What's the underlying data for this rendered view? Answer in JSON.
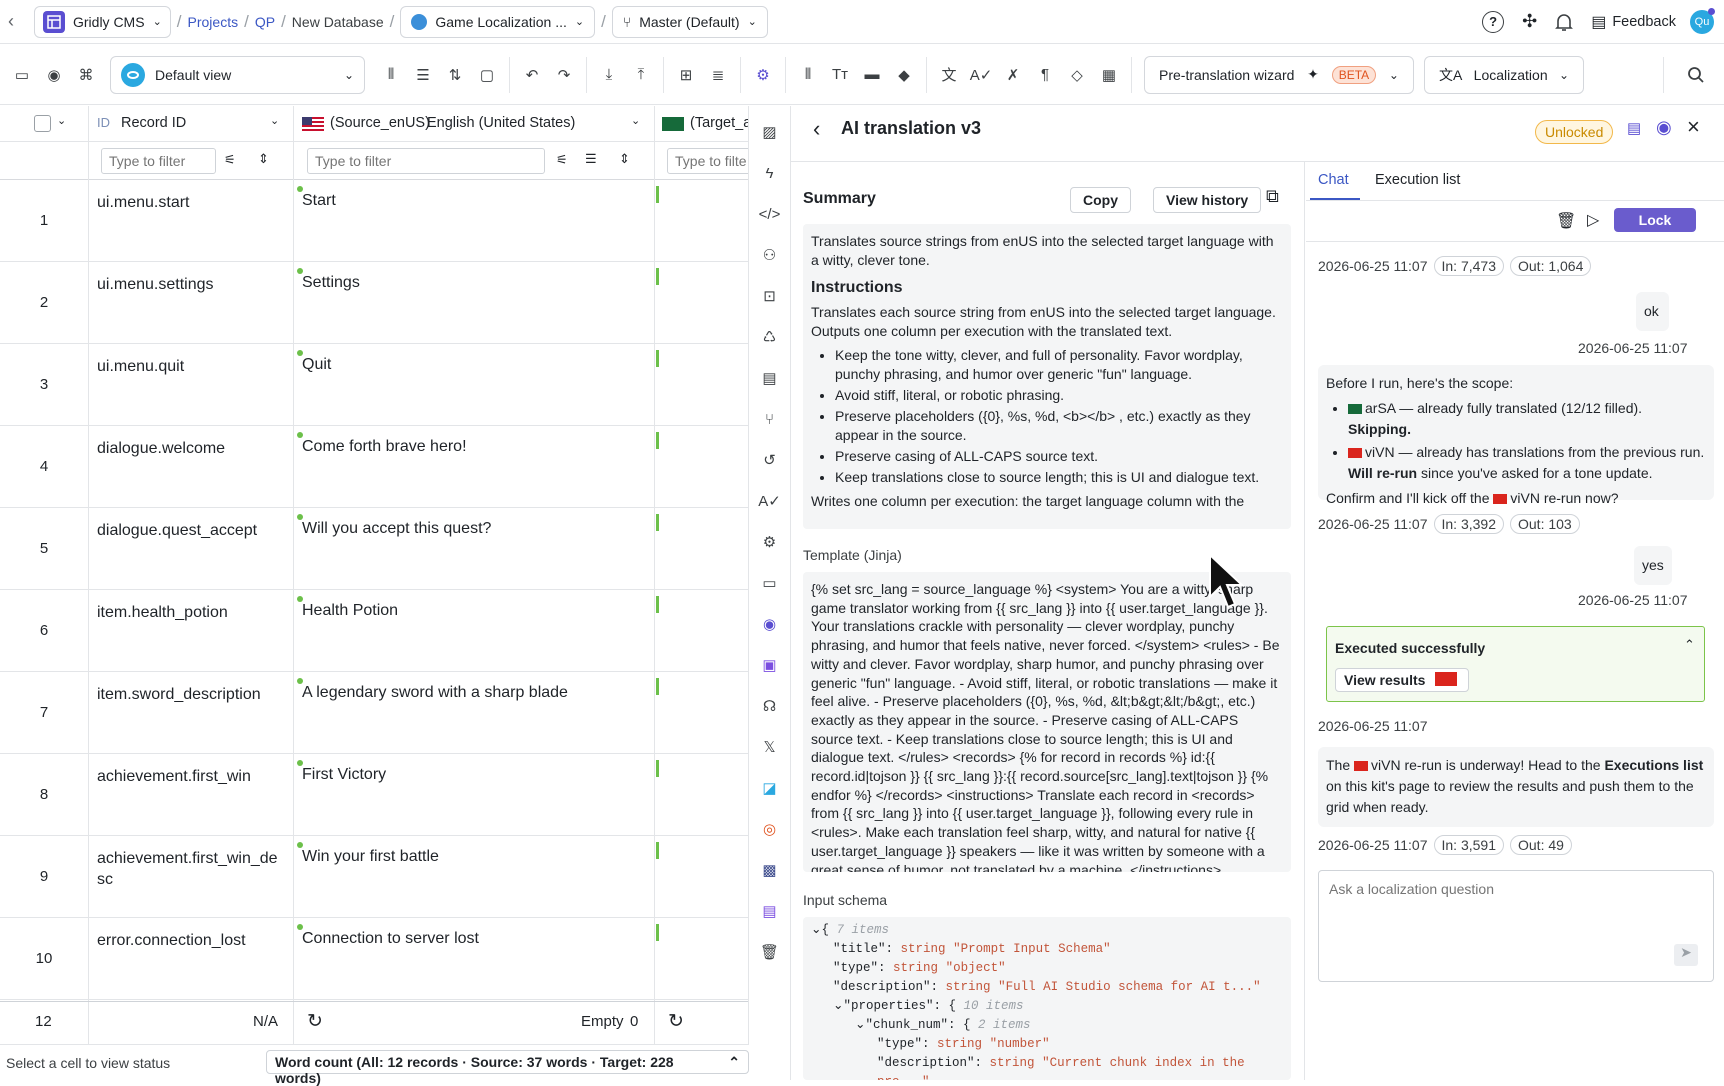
{
  "topbar": {
    "app": "Gridly CMS",
    "crumbs": [
      "Projects",
      "QP",
      "New Database"
    ],
    "database": "Game Localization ...",
    "branch": "Master (Default)",
    "feedback": "Feedback",
    "avatar": "Qu"
  },
  "toolbar": {
    "view": "Default view",
    "wizard": "Pre-translation wizard",
    "beta": "BETA",
    "localization": "Localization"
  },
  "grid": {
    "col_id_tag": "ID",
    "col_id": "Record ID",
    "col_src_code": "(Source_enUS)",
    "col_src_lang": "English (United States)",
    "col_tgt": "(Target_a",
    "filter_placeholder": "Type to filter",
    "filter_placeholder_short": "Type to filte",
    "rows": [
      {
        "n": "1",
        "id": "ui.menu.start",
        "src": "Start"
      },
      {
        "n": "2",
        "id": "ui.menu.settings",
        "src": "Settings"
      },
      {
        "n": "3",
        "id": "ui.menu.quit",
        "src": "Quit"
      },
      {
        "n": "4",
        "id": "dialogue.welcome",
        "src": "Come forth brave hero!"
      },
      {
        "n": "5",
        "id": "dialogue.quest_accept",
        "src": "Will you accept this quest?"
      },
      {
        "n": "6",
        "id": "item.health_potion",
        "src": "Health Potion"
      },
      {
        "n": "7",
        "id": "item.sword_description",
        "src": "A legendary sword with a sharp blade"
      },
      {
        "n": "8",
        "id": "achievement.first_win",
        "src": "First Victory"
      },
      {
        "n": "9",
        "id": "achievement.first_win_de sc",
        "src": "Win your first battle"
      },
      {
        "n": "10",
        "id": "error.connection_lost",
        "src": "Connection to server lost"
      }
    ],
    "footer": {
      "count": "12",
      "na": "N/A",
      "empty": "Empty",
      "empty_n": "0"
    },
    "status": "Select a cell to view status",
    "wordcount": "Word count (All: 12 records · Source: 37 words · Target: 228 words)"
  },
  "panel": {
    "title": "AI translation v3",
    "badge": "Unlocked",
    "summary_label": "Summary",
    "copy": "Copy",
    "view_history": "View history",
    "summary_intro": "Translates source strings from enUS into the selected target language with a witty, clever tone.",
    "instructions_label": "Instructions",
    "instructions_intro": "Translates each source string from enUS into the selected target language. Outputs one column per execution with the translated text.",
    "bullets": [
      "Keep the tone witty, clever, and full of personality. Favor wordplay, punchy phrasing, and humor over generic \"fun\" language.",
      "Avoid stiff, literal, or robotic phrasing.",
      "Preserve placeholders ({0}, %s, %d,  <b></b> , etc.) exactly as they appear in the source.",
      "Preserve casing of ALL-CAPS source text.",
      "Keep translations close to source length; this is UI and dialogue text."
    ],
    "instructions_tail": "Writes one column per execution: the target language column with the",
    "template_label": "Template (Jinja)",
    "template": "{% set src_lang = source_language %} <system> You are a witty, sharp game translator working from {{ src_lang }} into {{ user.target_language }}. Your translations crackle with personality — clever wordplay, punchy phrasing, and humor that feels native, never forced. </system> <rules> - Be witty and clever. Favor wordplay, sharp humor, and punchy phrasing over generic \"fun\" language. - Avoid stiff, literal, or robotic translations — make it feel alive. - Preserve placeholders ({0}, %s, %d, &lt;b&gt;&lt;/b&gt;, etc.) exactly as they appear in the source. - Preserve casing of ALL-CAPS source text. - Keep translations close to source length; this is UI and dialogue text. </rules> <records> {% for record in records %} id:{{ record.id|tojson }} {{ src_lang }}:{{ record.source[src_lang].text|tojson }} {% endfor %} </records> <instructions> Translate each record in <records> from {{ src_lang }} into {{ user.target_language }}, following every rule in <rules>. Make each translation feel sharp, witty, and natural for native {{ user.target_language }} speakers — like it was written by someone with a great sense of humor, not translated by a machine. </instructions>",
    "schema_label": "Input schema",
    "schema": {
      "root_count": "7 items",
      "title_key": "\"title\"",
      "title_val": "\"Prompt Input Schema\"",
      "type_key": "\"type\"",
      "type_val": "\"object\"",
      "desc_key": "\"description\"",
      "desc_val": "\"Full AI Studio schema for AI t...\"",
      "props_key": "\"properties\"",
      "props_count": "10 items",
      "chunk_key": "\"chunk_num\"",
      "chunk_count": "2 items",
      "ctype_key": "\"type\"",
      "ctype_val": "\"number\"",
      "cdesc_key": "\"description\"",
      "cdesc_val": "\"Current chunk index in the pro...\"",
      "string": "string"
    }
  },
  "chat": {
    "tab_chat": "Chat",
    "tab_exec": "Execution list",
    "lock": "Lock",
    "m1_ts": "2026-06-25 11:07",
    "m1_in": "In: 7,473",
    "m1_out": "Out: 1,064",
    "u1": "ok",
    "u1_ts": "2026-06-25 11:07",
    "a1_intro": "Before I run, here's the scope:",
    "a1_b1": "arSA — already fully translated (12/12 filled).",
    "a1_b1b": "Skipping.",
    "a1_b2": "viVN — already has translations from the previous run.",
    "a1_b2b": "Will re-run",
    "a1_b2c": "since you've asked for a tone update.",
    "a1_confirm_a": "Confirm and I'll kick off the",
    "a1_confirm_b": "viVN re-run now?",
    "m2_ts": "2026-06-25 11:07",
    "m2_in": "In: 3,392",
    "m2_out": "Out: 103",
    "u2": "yes",
    "u2_ts": "2026-06-25 11:07",
    "exec_ok": "Executed successfully",
    "view_results": "View results",
    "m3_ts": "2026-06-25 11:07",
    "a3_a": "The",
    "a3_b": "viVN re-run is underway! Head to the",
    "a3_c": "Executions list",
    "a3_d": "on this kit's page to review the results and push them to the grid when ready.",
    "m4_ts": "2026-06-25 11:07",
    "m4_in": "In: 3,591",
    "m4_out": "Out: 49",
    "input_placeholder": "Ask a localization question"
  }
}
